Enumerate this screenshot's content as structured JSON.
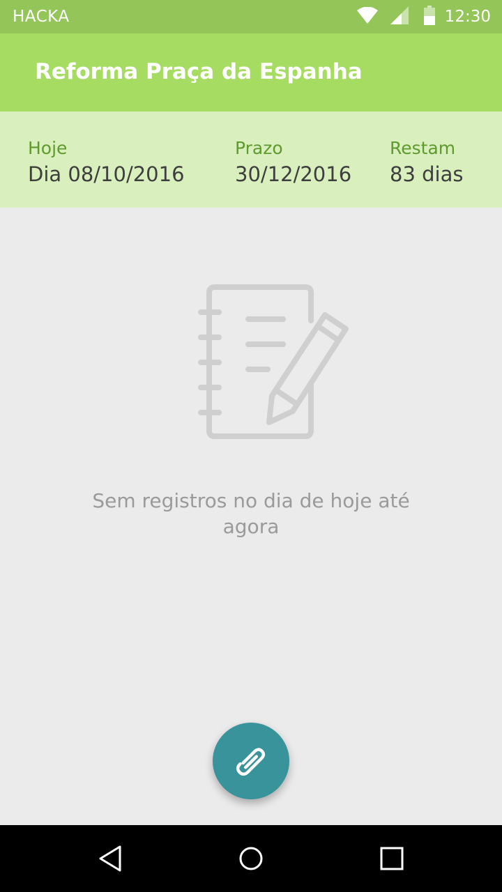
{
  "status_bar": {
    "carrier": "HACKA",
    "time": "12:30",
    "icons": [
      "wifi-icon",
      "signal-icon",
      "battery-icon"
    ]
  },
  "app_bar": {
    "title": "Reforma Praça da Espanha"
  },
  "info": {
    "today_label": "Hoje",
    "today_value": "Dia 08/10/2016",
    "deadline_label": "Prazo",
    "deadline_value": "30/12/2016",
    "remaining_label": "Restam",
    "remaining_value": "83 dias"
  },
  "empty_state": {
    "icon": "notebook-pencil-icon",
    "message": "Sem registros no dia de hoje até agora"
  },
  "fab": {
    "icon": "paperclip-icon"
  },
  "nav_bar": {
    "icons": [
      "back-icon",
      "home-icon",
      "recents-icon"
    ]
  },
  "colors": {
    "status_bar": "#94c558",
    "app_bar": "#a6dc62",
    "info_strip": "#d9efbd",
    "label_green": "#5f9a2e",
    "fab": "#38939a",
    "background": "#ebebeb"
  }
}
